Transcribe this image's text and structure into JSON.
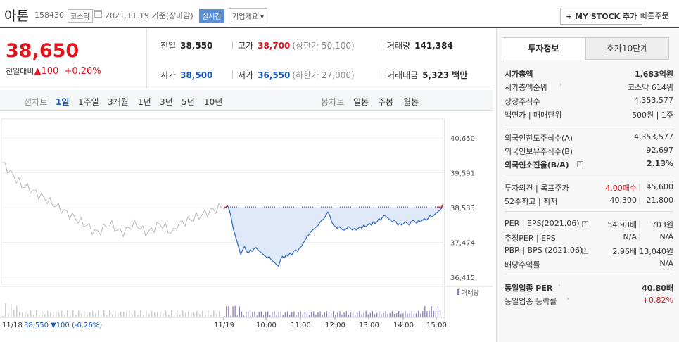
{
  "header": {
    "name": "아톤",
    "code": "158430",
    "market": "코스닥",
    "date": "2021.11.19  기준(장마감)",
    "live": "실시간",
    "company_info": "기업개요 ▾",
    "mystock": "+ MY STOCK 추가",
    "quick_order": "빠른주문"
  },
  "price": {
    "current": "38,650",
    "diff_label": "전일대비",
    "diff": "▲100",
    "rate": "+0.26%"
  },
  "quote": {
    "prev_label": "전일",
    "prev": "38,550",
    "high_label": "고가",
    "high": "38,700",
    "upper_limit": "(상한가 50,100)",
    "volume_label": "거래량",
    "volume": "141,384",
    "open_label": "시가",
    "open": "38,500",
    "low_label": "저가",
    "low": "36,550",
    "lower_limit": "(하한가 27,000)",
    "amount_label": "거래대금",
    "amount": "5,323 백만"
  },
  "tabs": {
    "line_chart": "선차트",
    "periods": [
      "1일",
      "1주일",
      "3개월",
      "1년",
      "3년",
      "5년",
      "10년"
    ],
    "candle_chart": "봉차트",
    "candle_periods": [
      "일봉",
      "주봉",
      "월봉"
    ]
  },
  "chart_data": {
    "type": "line",
    "ylim": [
      36415,
      40650
    ],
    "y_ticks": [
      "40,650",
      "39,591",
      "38,533",
      "37,474",
      "36,415"
    ],
    "x_ticks": [
      "11/19",
      "10:00",
      "11:00",
      "12:00",
      "13:00",
      "14:00",
      "15:00"
    ],
    "prev_close": 38550,
    "volume_label": "거래량",
    "footer": {
      "date": "11/18",
      "price": "38,550",
      "change": "▼100 (-0.26%)"
    },
    "series": [
      {
        "values": [
          38500,
          38540,
          38580,
          38450,
          38200,
          37900,
          37700,
          37500,
          37300,
          37100,
          37250,
          37350,
          37200,
          37150,
          37250,
          37200,
          37280,
          37320,
          37250,
          37200,
          37150,
          37100,
          37050,
          37000,
          37050,
          36950,
          36900,
          36850,
          36800,
          36750,
          36950,
          37050,
          37000,
          37100,
          37050,
          37150,
          37100,
          37200,
          37250,
          37200,
          37300,
          37350,
          37450,
          37550,
          37650,
          37700,
          37800,
          37850,
          37900,
          37950,
          38000,
          38100,
          38150,
          38200,
          38300,
          38400,
          38300,
          38100,
          38000,
          37950,
          37900,
          37950,
          37900,
          37850,
          37850,
          37900,
          37950,
          37900,
          37850,
          37900,
          37850,
          37900,
          37950,
          37900,
          38000,
          37950,
          38000,
          38050,
          38000,
          38100,
          38050,
          38100,
          38200,
          38150,
          38250,
          38300,
          38250,
          38200,
          38150,
          38100,
          38150,
          38100,
          38000,
          38050,
          38000,
          38050,
          38100,
          38050,
          38000,
          38100,
          38150,
          38100,
          38050,
          38150,
          38100,
          38150,
          38200,
          38150,
          38200,
          38300,
          38250,
          38300,
          38350,
          38400,
          38450,
          38500,
          38650
        ]
      }
    ]
  },
  "panel": {
    "tab_active": "투자정보",
    "tab_other": "호가10단계",
    "rows": [
      {
        "label": "시가총액",
        "value": "1,683억원"
      },
      {
        "label": "시가총액순위",
        "value": "코스닥 614위"
      },
      {
        "label": "상장주식수",
        "value": "4,353,577"
      },
      {
        "label": "액면가 | 매매단위",
        "value": "500원 | 1주"
      },
      {
        "label": "외국인한도주식수(A)",
        "value": "4,353,577"
      },
      {
        "label": "외국인보유주식수(B)",
        "value": "92,697"
      },
      {
        "label": "외국인소진율(B/A)",
        "value": "2.13%"
      },
      {
        "label": "투자의견 | 목표주가",
        "value_a": "4.00매수",
        "value_b": "45,600"
      },
      {
        "label": "52주최고 | 최저",
        "value_a": "40,300",
        "value_b": "21,800"
      },
      {
        "label": "PER | EPS(2021.06)",
        "value_a": "54.98배",
        "value_b": "703원"
      },
      {
        "label": "추정PER | EPS",
        "value_a": "N/A",
        "value_b": "N/A"
      },
      {
        "label": "PBR | BPS (2021.06)",
        "value_a": "2.96배",
        "value_b": "13,040원"
      },
      {
        "label": "배당수익률",
        "value": "N/A"
      },
      {
        "label": "동일업종 PER",
        "value": "40.80배"
      },
      {
        "label": "동일업종 등락률",
        "value": "+0.82%"
      }
    ]
  },
  "colors": {
    "up": "#e0141d",
    "down": "#1557c0",
    "accent": "#5a8fd6"
  }
}
